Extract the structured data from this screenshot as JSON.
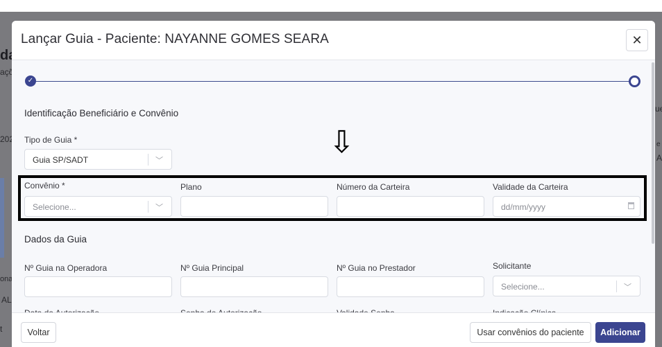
{
  "background": {
    "frag_title": "da",
    "frag_text1": "açõ",
    "frag_year": "202",
    "frag_onal": "onal",
    "frag_al": "AL",
    "frag_t": "t",
    "frag_ue": "ue",
    "frag_right_e": "e",
    "frag_right_a": "A"
  },
  "modal": {
    "title": "Lançar Guia - Paciente: NAYANNE GOMES SEARA",
    "close_symbol": "✕",
    "stepper": {
      "done_symbol": "✓"
    },
    "sections": {
      "identificacao": "Identificação Beneficiário e Convênio",
      "dados": "Dados da Guia"
    },
    "fields": {
      "tipo_guia": {
        "label": "Tipo de Guia *",
        "value": "Guia SP/SADT"
      },
      "convenio": {
        "label": "Convênio *",
        "placeholder": "Selecione..."
      },
      "plano": {
        "label": "Plano",
        "value": ""
      },
      "numero_carteira": {
        "label": "Número da Carteira",
        "value": ""
      },
      "validade_carteira": {
        "label": "Validade da Carteira",
        "placeholder": "dd/mm/yyyy"
      },
      "guia_operadora": {
        "label": "Nº Guia na Operadora",
        "value": ""
      },
      "guia_principal": {
        "label": "Nº Guia Principal",
        "value": ""
      },
      "guia_prestador": {
        "label": "Nº Guia no Prestador",
        "value": ""
      },
      "solicitante": {
        "label": "Solicitante",
        "placeholder": "Selecione..."
      },
      "data_autorizacao": {
        "label": "Data da Autorização"
      },
      "senha_autorizacao": {
        "label": "Senha de Autorização"
      },
      "validade_senha": {
        "label": "Validade Senha"
      },
      "indicacao_clinica": {
        "label": "Indicação Clínica"
      }
    },
    "footer": {
      "voltar": "Voltar",
      "usar_convenios": "Usar convênios do paciente",
      "adicionar": "Adicionar"
    }
  },
  "annotation": {
    "arrow": "⇩"
  },
  "colors": {
    "primary": "#3b4590",
    "highlight_border": "#000000"
  }
}
